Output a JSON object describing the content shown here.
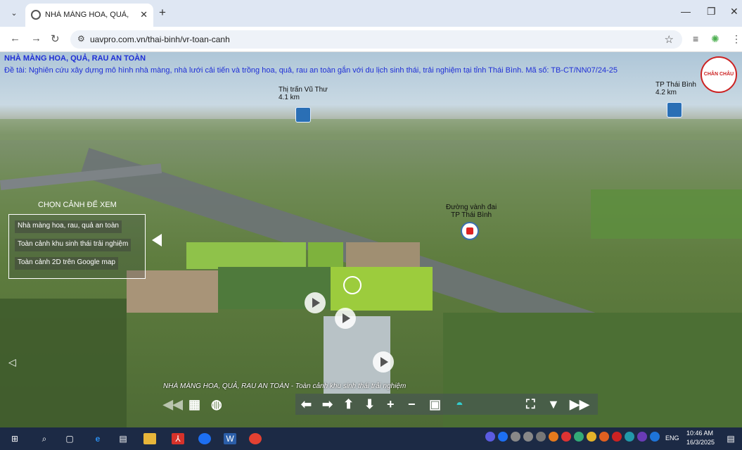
{
  "browser": {
    "tab_title": "NHÀ MÀNG HOA, QUẢ, RAU A",
    "url": "uavpro.com.vn/thai-binh/vr-toan-canh"
  },
  "page": {
    "title": "NHÀ MÀNG HOA, QUẢ, RAU AN TOÀN",
    "subtitle": "Đề tài: Nghiên cứu xây dựng mô hình nhà màng, nhà lưới cải tiến và trồng hoa, quả, rau an toàn gắn với du lịch sinh thái, trải nghiệm tại tỉnh Thái Bình. Mã số: TB-CT/NN07/24-25",
    "logo_text": "CHÂN CHÂU"
  },
  "hotspots": [
    {
      "name": "Thị trấn Vũ Thư",
      "distance": "4.1 km"
    },
    {
      "name": "TP Thái Bình",
      "distance": "4.2 km"
    },
    {
      "name": "Đường vành đai",
      "distance": "TP Thái Bình"
    }
  ],
  "scene_menu": {
    "title": "CHỌN CẢNH ĐỂ XEM",
    "items": [
      "Nhà màng hoa, rau, quả an toàn",
      "Toàn cảnh khu sinh thái trải nghiệm",
      "Toàn cảnh 2D trên Google map"
    ]
  },
  "caption": "NHÀ MÀNG HOA, QUẢ, RAU AN TOÀN - Toàn cảnh khu sinh thái trải nghiệm",
  "taskbar": {
    "language": "ENG",
    "time": "10:46 AM",
    "date": "16/3/2025"
  }
}
